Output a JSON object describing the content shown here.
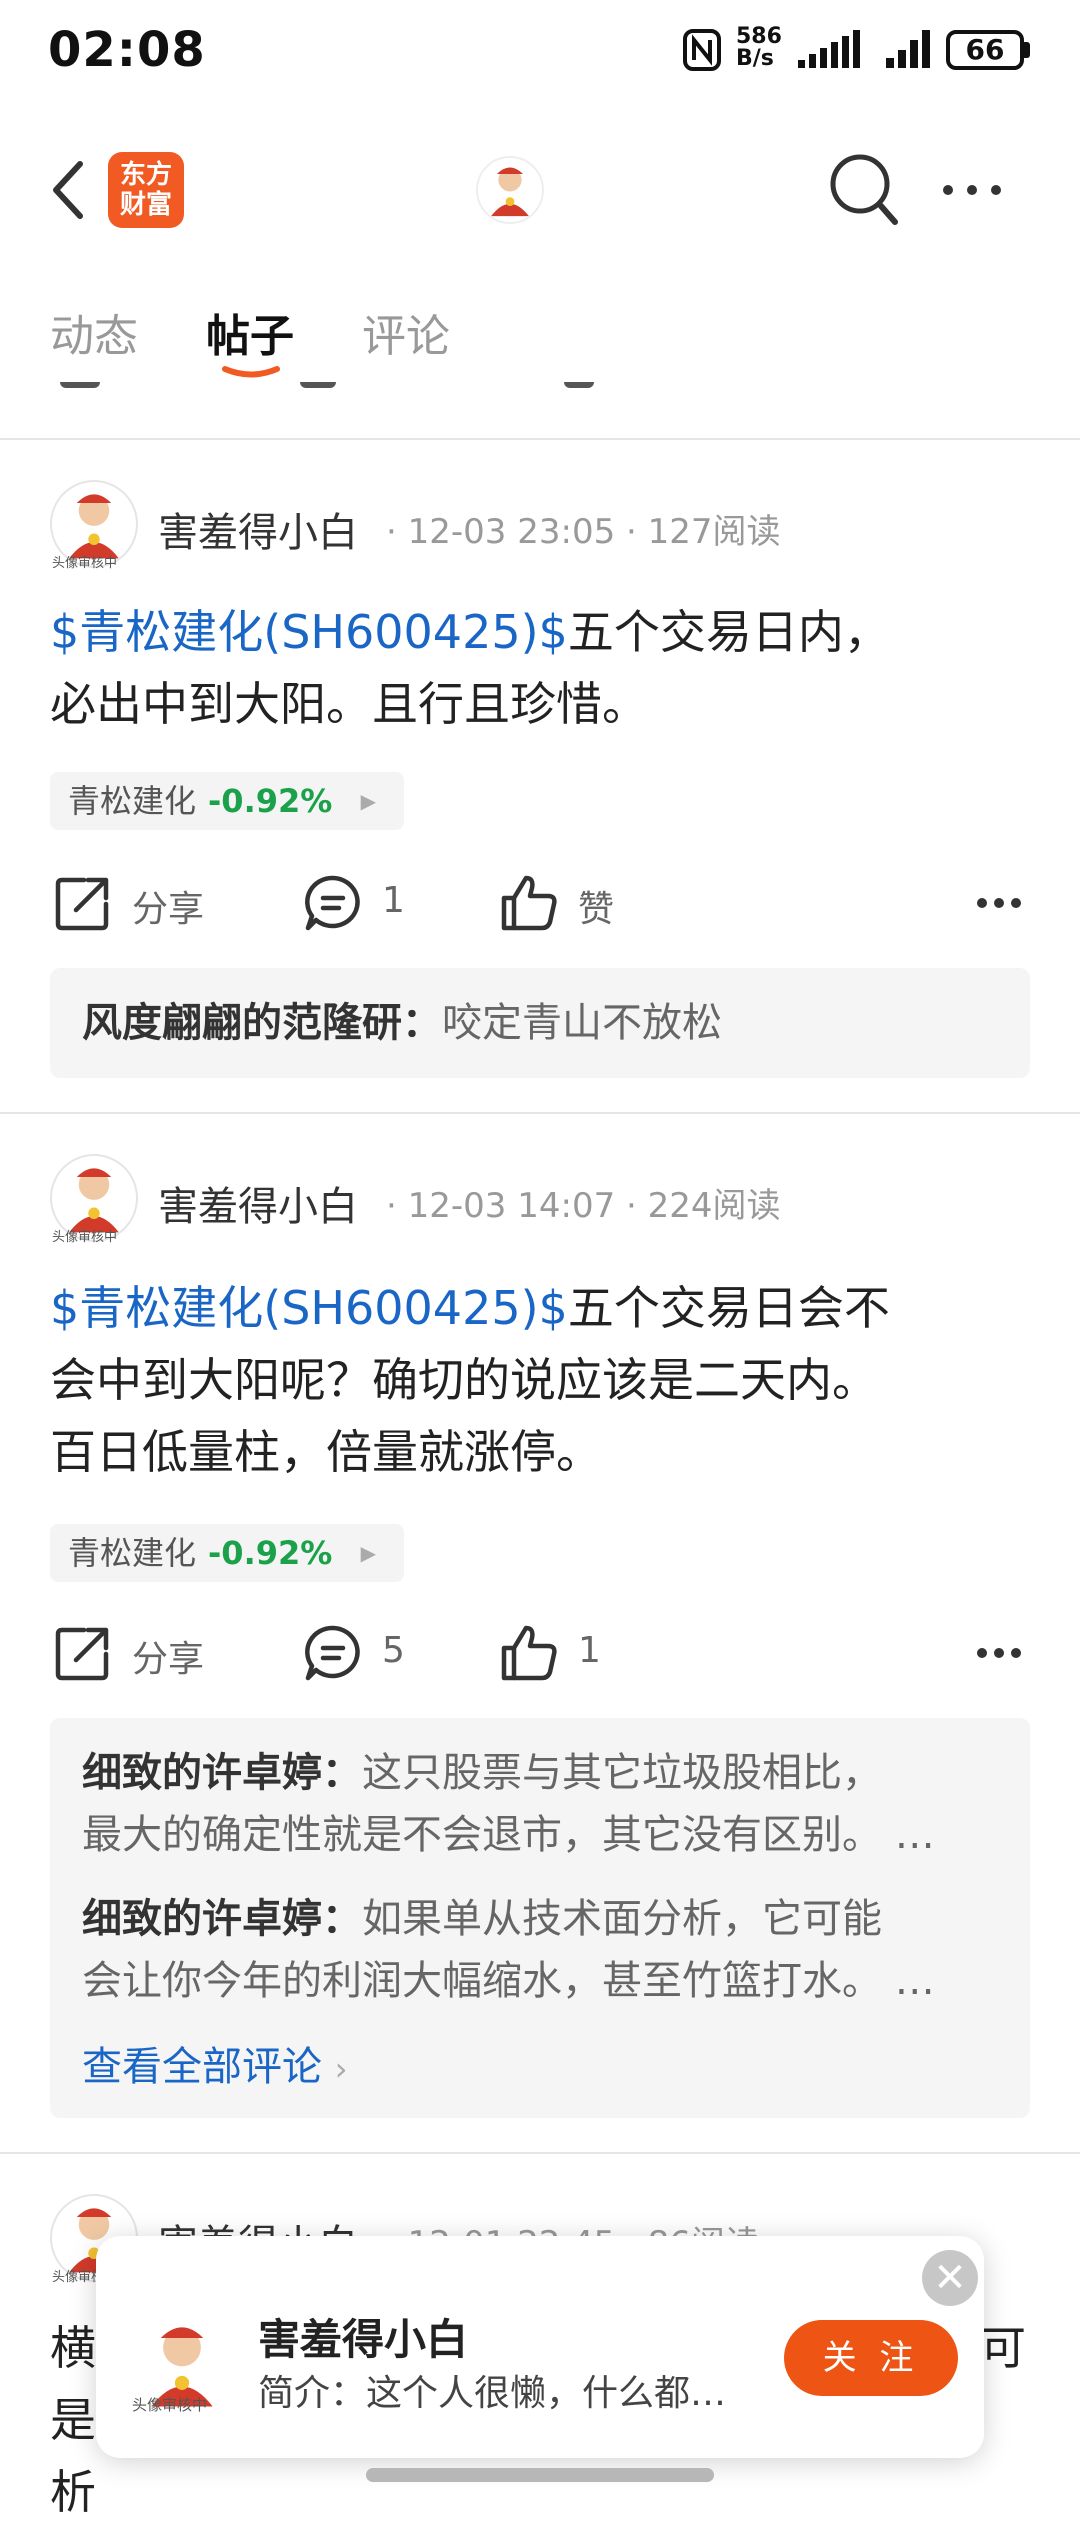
{
  "status_bar": {
    "time": "02:08",
    "net_speed_top": "586",
    "net_speed_bottom": "B/s",
    "battery": "66"
  },
  "header": {
    "logo_line1": "东方",
    "logo_line2": "财富"
  },
  "tabs": [
    {
      "label": "动态"
    },
    {
      "label": "帖子"
    },
    {
      "label": "评论"
    }
  ],
  "posts": [
    {
      "author": "害羞得小白",
      "time": "12-03 23:05",
      "reads": "127阅读",
      "tag": "$青松建化(SH600425)$",
      "body_rest": "五个交易日内，",
      "body_line2": "必出中到大阳。且行且珍惜。",
      "stock_name": "青松建化",
      "stock_change": "-0.92%",
      "share_label": "分享",
      "comment_count": "1",
      "like_label": "赞",
      "comments": [
        {
          "user": "风度翩翩的范隆研：",
          "text": "咬定青山不放松"
        }
      ]
    },
    {
      "author": "害羞得小白",
      "time": "12-03 14:07",
      "reads": "224阅读",
      "tag": "$青松建化(SH600425)$",
      "body_rest": "五个交易日会不",
      "body_line2": "会中到大阳呢？确切的说应该是二天内。",
      "body_line3": "百日低量柱，倍量就涨停。",
      "stock_name": "青松建化",
      "stock_change": "-0.92%",
      "share_label": "分享",
      "comment_count": "5",
      "like_label": "1",
      "comments": [
        {
          "user": "细致的许卓婷：",
          "text": "这只股票与其它垃圾股相比，",
          "text2": "最大的确定性就是不会退市，其它没有区别。 …"
        },
        {
          "user": "细致的许卓婷：",
          "text": "如果单从技术面分析，它可能",
          "text2": "会让你今年的利润大幅缩水，甚至竹篮打水。 …"
        }
      ],
      "view_all": "查看全部评论"
    },
    {
      "author": "害羞得小白",
      "time": "12-01 22:45",
      "reads": "86阅读",
      "body_partial": "横",
      "body_partial_end": "可",
      "body_partial2": "是",
      "body_partial3": "析"
    }
  ],
  "avatar_caption": "头像审核中",
  "popup": {
    "name": "害羞得小白",
    "bio": "简介：这个人很懒，什么都…",
    "follow_label": "关 注",
    "close": "✕"
  },
  "colors": {
    "brand": "#f15a22",
    "link": "#1a66c7",
    "down": "#1aa14a",
    "follow": "#ee5514"
  }
}
